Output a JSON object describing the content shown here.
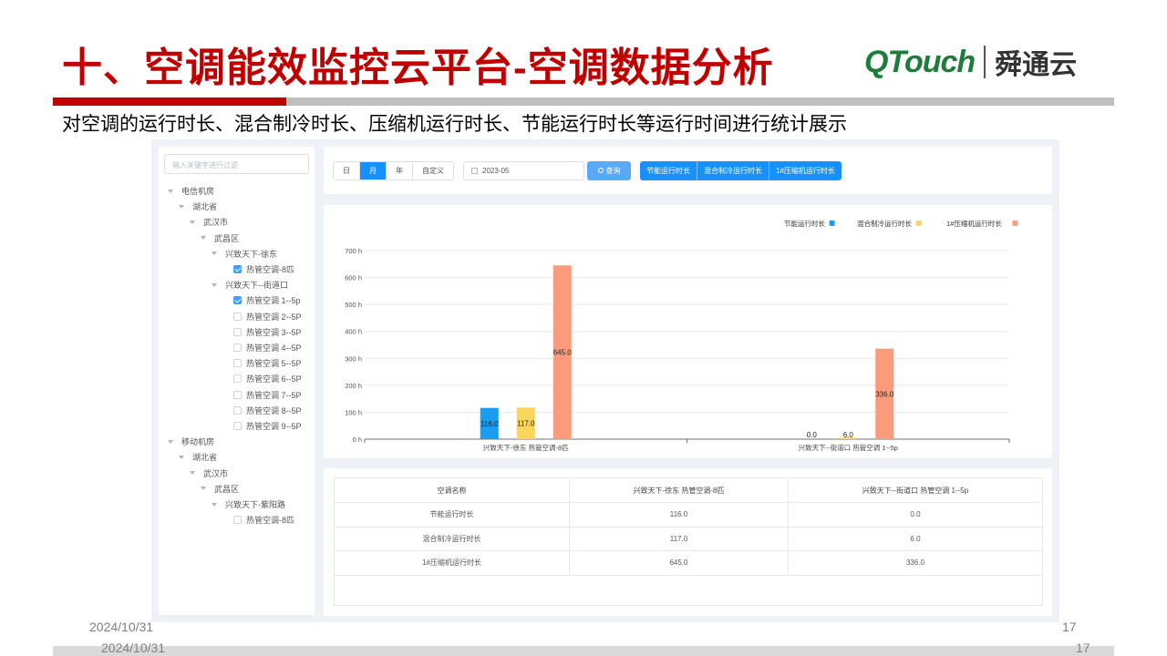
{
  "slide": {
    "title": "十、空调能效监控云平台-空调数据分析",
    "logo_brand": "QTouch",
    "logo_cn": "舜通云",
    "subtitle": "对空调的运行时长、混合制冷时长、压缩机运行时长、节能运行时长等运行时间进行统计展示",
    "footer_date": "2024/10/31",
    "footer_page": "17",
    "accent_color": "#c00000"
  },
  "sidebar": {
    "search_placeholder": "输入关键字进行过滤",
    "tree": [
      {
        "label": "电信机房",
        "level": 0,
        "type": "branch"
      },
      {
        "label": "湖北省",
        "level": 1,
        "type": "branch"
      },
      {
        "label": "武汉市",
        "level": 2,
        "type": "branch"
      },
      {
        "label": "武昌区",
        "level": 3,
        "type": "branch"
      },
      {
        "label": "兴致天下-徐东",
        "level": 4,
        "type": "branch"
      },
      {
        "label": "热管空调-8匹",
        "level": 5,
        "type": "leaf",
        "checked": true
      },
      {
        "label": "兴致天下--街道口",
        "level": 4,
        "type": "branch"
      },
      {
        "label": "热管空调 1--5p",
        "level": 5,
        "type": "leaf",
        "checked": true
      },
      {
        "label": "热管空调 2--5P",
        "level": 5,
        "type": "leaf",
        "checked": false
      },
      {
        "label": "热管空调 3--5P",
        "level": 5,
        "type": "leaf",
        "checked": false
      },
      {
        "label": "热管空调 4--5P",
        "level": 5,
        "type": "leaf",
        "checked": false
      },
      {
        "label": "热管空调 5--5P",
        "level": 5,
        "type": "leaf",
        "checked": false
      },
      {
        "label": "热管空调 6--5P",
        "level": 5,
        "type": "leaf",
        "checked": false
      },
      {
        "label": "热管空调 7--5P",
        "level": 5,
        "type": "leaf",
        "checked": false
      },
      {
        "label": "热管空调 8--5P",
        "level": 5,
        "type": "leaf",
        "checked": false
      },
      {
        "label": "热管空调 9--5P",
        "level": 5,
        "type": "leaf",
        "checked": false
      },
      {
        "label": "移动机房",
        "level": 0,
        "type": "branch"
      },
      {
        "label": "湖北省",
        "level": 1,
        "type": "branch"
      },
      {
        "label": "武汉市",
        "level": 2,
        "type": "branch"
      },
      {
        "label": "武昌区",
        "level": 3,
        "type": "branch"
      },
      {
        "label": "兴致天下-紫阳路",
        "level": 4,
        "type": "branch"
      },
      {
        "label": "热管空调-8匹",
        "level": 5,
        "type": "leaf",
        "checked": false
      }
    ]
  },
  "toolbar": {
    "period_buttons": [
      "日",
      "月",
      "年",
      "自定义"
    ],
    "active_period": "月",
    "date_value": "2023-05",
    "query_label": "查询",
    "metric_buttons": [
      "节能运行时长",
      "混合制冷运行时长",
      "1#压缩机运行时长"
    ]
  },
  "chart_data": {
    "type": "bar",
    "categories": [
      "兴致天下-徐东 热管空调-8匹",
      "兴致天下--街道口 热管空调 1--5p"
    ],
    "series": [
      {
        "name": "节能运行时长",
        "color": "#1a9cf0",
        "values": [
          116.0,
          0.0
        ]
      },
      {
        "name": "混合制冷运行时长",
        "color": "#fad55c",
        "values": [
          117.0,
          6.0
        ]
      },
      {
        "name": "1#压缩机运行时长",
        "color": "#fc9a7c",
        "values": [
          645.0,
          336.0
        ]
      }
    ],
    "data_labels": [
      [
        "116.0",
        "0.0"
      ],
      [
        "117.0",
        "6.0"
      ],
      [
        "645.0",
        "336.0"
      ]
    ],
    "y_ticks": [
      "0 h",
      "100 h",
      "200 h",
      "300 h",
      "400 h",
      "500 h",
      "600 h",
      "700 h"
    ],
    "ylim": [
      0,
      700
    ],
    "grid": true,
    "legend_position": "top-right"
  },
  "table": {
    "headers": [
      "空调名称",
      "兴致天下-徐东 热管空调-8匹",
      "兴致天下--街道口 热管空调 1--5p"
    ],
    "rows": [
      [
        "节能运行时长",
        "116.0",
        "0.0"
      ],
      [
        "混合制冷运行时长",
        "117.0",
        "6.0"
      ],
      [
        "1#压缩机运行时长",
        "645.0",
        "336.0"
      ]
    ]
  }
}
